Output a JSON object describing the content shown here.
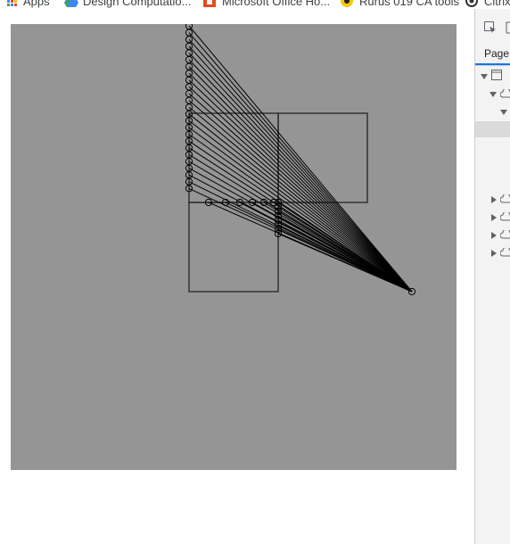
{
  "bookmarks": [
    {
      "label": "Apps",
      "icon": "apps-grid-icon"
    },
    {
      "label": "Design Computatio...",
      "icon": "google-drive-icon"
    },
    {
      "label": "Microsoft Office Ho...",
      "icon": "office-icon"
    },
    {
      "label": "Rurus 019 CA tools",
      "icon": "rurus-icon"
    },
    {
      "label": "Citrix",
      "icon": "citrix-icon"
    }
  ],
  "devtools": {
    "tab_label": "Page",
    "icons": [
      "inspect-element-icon",
      "device-toolbar-icon"
    ],
    "tree_icons": [
      "window-frame-icon",
      "cloud-icon"
    ]
  },
  "colors": {
    "canvas_bg": "#959595",
    "stroke": "#000000",
    "box_stroke": "#333333",
    "accent": "#1a73e8"
  }
}
